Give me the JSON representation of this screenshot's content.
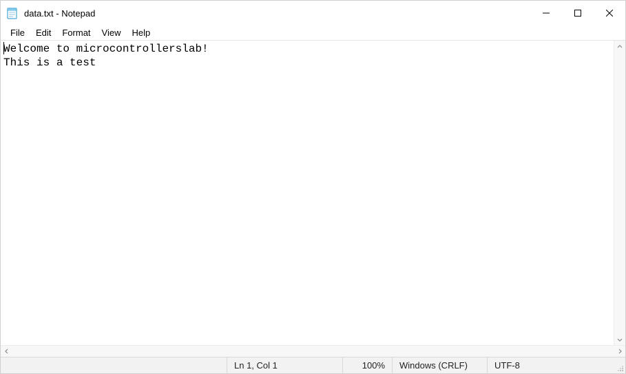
{
  "window": {
    "title": "data.txt - Notepad"
  },
  "menu": {
    "file": "File",
    "edit": "Edit",
    "format": "Format",
    "view": "View",
    "help": "Help"
  },
  "editor": {
    "content": "Welcome to microcontrollerslab!\nThis is a test"
  },
  "status": {
    "position": "Ln 1, Col 1",
    "zoom": "100%",
    "line_ending": "Windows (CRLF)",
    "encoding": "UTF-8"
  }
}
